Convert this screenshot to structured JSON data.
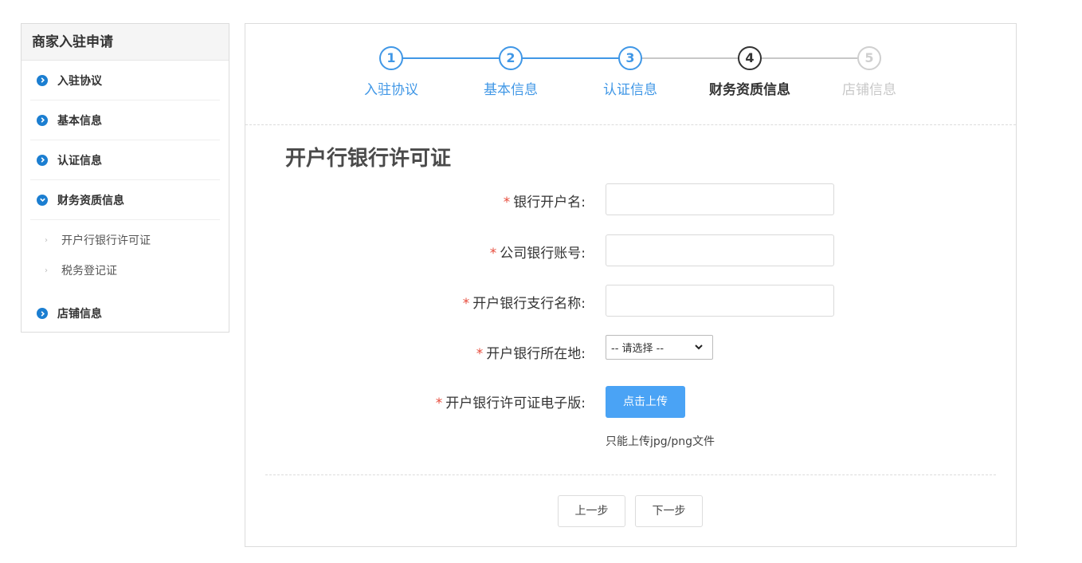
{
  "sidebar": {
    "title": "商家入驻申请",
    "items": [
      {
        "label": "入驻协议",
        "icon": "chevron-right-icon",
        "expanded": false
      },
      {
        "label": "基本信息",
        "icon": "chevron-right-icon",
        "expanded": false
      },
      {
        "label": "认证信息",
        "icon": "chevron-right-icon",
        "expanded": false
      },
      {
        "label": "财务资质信息",
        "icon": "chevron-down-icon",
        "expanded": true,
        "children": [
          {
            "label": "开户行银行许可证"
          },
          {
            "label": "税务登记证"
          }
        ]
      },
      {
        "label": "店铺信息",
        "icon": "chevron-right-icon",
        "expanded": false
      }
    ]
  },
  "steps": [
    {
      "number": "1",
      "label": "入驻协议",
      "status": "done"
    },
    {
      "number": "2",
      "label": "基本信息",
      "status": "done"
    },
    {
      "number": "3",
      "label": "认证信息",
      "status": "done"
    },
    {
      "number": "4",
      "label": "财务资质信息",
      "status": "active"
    },
    {
      "number": "5",
      "label": "店铺信息",
      "status": "todo"
    }
  ],
  "section_title": "开户行银行许可证",
  "form": {
    "required_mark": "*",
    "account_name": {
      "label": "银行开户名:",
      "value": ""
    },
    "account_number": {
      "label": "公司银行账号:",
      "value": ""
    },
    "branch_name": {
      "label": "开户银行支行名称:",
      "value": ""
    },
    "location": {
      "label": "开户银行所在地:",
      "selected": "-- 请选择 --"
    },
    "license_file": {
      "label": "开户银行许可证电子版:",
      "button": "点击上传",
      "hint": "只能上传jpg/png文件"
    }
  },
  "buttons": {
    "prev": "上一步",
    "next": "下一步"
  },
  "colors": {
    "accent": "#4097e6",
    "sidebar_icon": "#1b7ed1",
    "upload": "#4aa3f5",
    "required": "#e74c3c"
  }
}
